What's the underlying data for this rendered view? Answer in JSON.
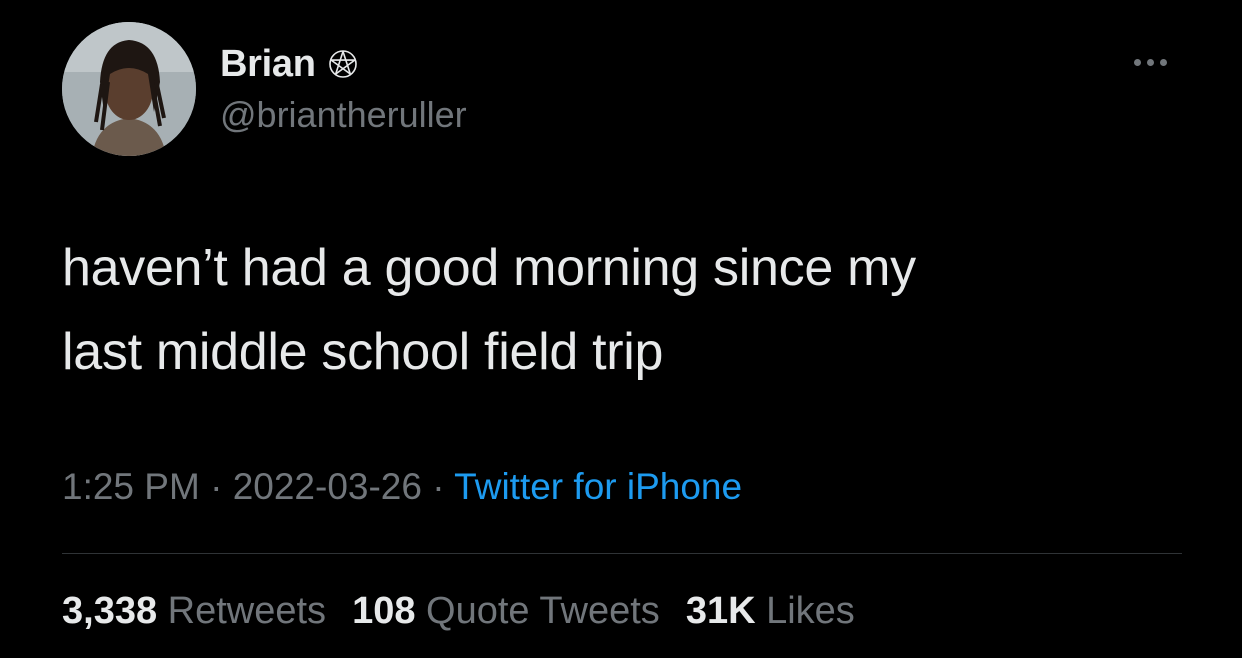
{
  "author": {
    "display_name": "Brian",
    "name_emoji": "pentagram-icon",
    "handle": "@briantheruller"
  },
  "tweet": {
    "text": "haven’t had a good morning since my\nlast middle school field trip",
    "time": "1:25 PM",
    "separator": " · ",
    "date": "2022-03-26",
    "source": "Twitter for iPhone"
  },
  "stats": {
    "retweets_count": "3,338",
    "retweets_label": "Retweets",
    "quotes_count": "108",
    "quotes_label": "Quote Tweets",
    "likes_count": "31K",
    "likes_label": "Likes"
  },
  "colors": {
    "background": "#000000",
    "primary_text": "#e7e9ea",
    "secondary_text": "#71767b",
    "link": "#1d9bf0",
    "divider": "#2f3336"
  }
}
